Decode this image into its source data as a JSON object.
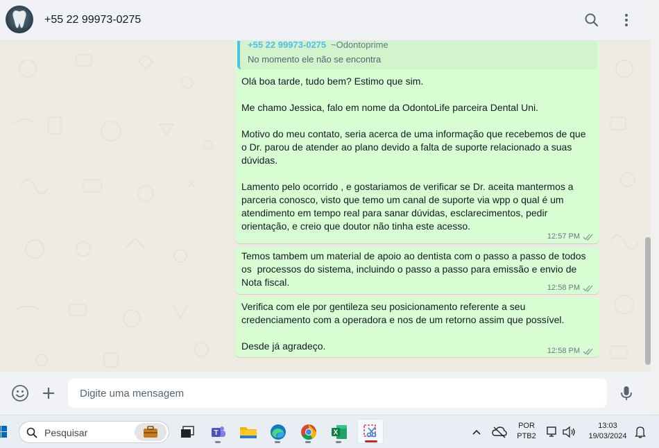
{
  "header": {
    "contact_name": "+55 22 99973-0275",
    "icons": [
      "search-icon",
      "menu-icon"
    ]
  },
  "messages": [
    {
      "quote": {
        "author": "+55 22 99973-0275",
        "sub": "~Odontoprime",
        "text": "No  momento ele não se encontra"
      },
      "text": "Olá boa tarde, tudo bem? Estimo que sim.\n\nMe chamo Jessica, falo em nome da OdontoLife parceira Dental Uni.\n\nMotivo do meu contato, seria acerca de uma informação que recebemos de que o Dr. parou de atender ao plano devido a falta de suporte relacionado a suas dúvidas.\n\nLamento pelo ocorrido , e gostariamos de verificar se Dr. aceita mantermos a parceria conosco, visto que temo um canal de suporte via wpp o qual é um atendimento em tempo real para sanar dúvidas, esclarecimentos, pedir orientação, e creio que doutor não tinha este acesso.",
      "time": "12:57 PM",
      "status": "read"
    },
    {
      "text": "Temos tambem um material de apoio ao dentista com o passo a passo de todos os  processos do sistema, incluindo o passo a passo para emissão e envio de Nota fiscal.",
      "time": "12:58 PM",
      "status": "read"
    },
    {
      "text": "Verifica com ele por gentileza seu posicionamento referente a seu credenciamento com a operadora e nos de um retorno assim que possível.\n\nDesde já agradeço.",
      "time": "12:58 PM",
      "status": "read"
    }
  ],
  "compose": {
    "placeholder": "Digite uma mensagem",
    "icons": [
      "emoji-icon",
      "plus-icon",
      "mic-icon"
    ]
  },
  "taskbar": {
    "search_label": "Pesquisar",
    "apps": [
      "windows-start-icon",
      "file-explorer-briefcase-icon",
      "task-view-icon",
      "teams-icon",
      "folder-icon",
      "edge-icon",
      "chrome-icon",
      "excel-icon",
      "snipping-tool-icon"
    ],
    "tray": {
      "lang_top": "POR",
      "lang_bottom": "PTB2",
      "time": "13:03",
      "date": "19/03/2024"
    }
  },
  "colors": {
    "outgoing_bubble": "#d9fdd3",
    "quote_accent": "#53bdeb",
    "read_ticks": "#8696a0",
    "chat_bg": "#efeae2"
  }
}
